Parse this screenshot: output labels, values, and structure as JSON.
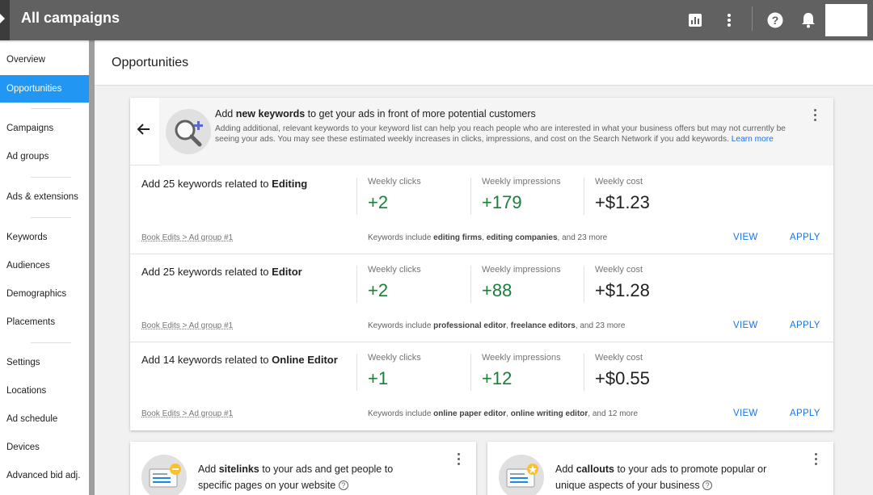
{
  "topbar": {
    "title": "All campaigns",
    "icons": [
      "reports-icon",
      "more-vert-icon",
      "help-icon",
      "notifications-icon"
    ]
  },
  "sidebar": {
    "items": [
      {
        "label": "Overview",
        "active": false
      },
      {
        "label": "Opportunities",
        "active": true
      },
      {
        "label": "Campaigns",
        "active": false
      },
      {
        "label": "Ad groups",
        "active": false
      },
      {
        "label": "Ads & extensions",
        "active": false
      },
      {
        "label": "Keywords",
        "active": false
      },
      {
        "label": "Audiences",
        "active": false
      },
      {
        "label": "Demographics",
        "active": false
      },
      {
        "label": "Placements",
        "active": false
      },
      {
        "label": "Settings",
        "active": false
      },
      {
        "label": "Locations",
        "active": false
      },
      {
        "label": "Ad schedule",
        "active": false
      },
      {
        "label": "Devices",
        "active": false
      },
      {
        "label": "Advanced bid adj.",
        "active": false
      }
    ]
  },
  "page": {
    "title": "Opportunities"
  },
  "keywords_card": {
    "title_pre": "Add ",
    "title_bold": "new keywords",
    "title_post": " to get your ads in front of more potential customers",
    "description": "Adding additional, relevant keywords to your keyword list can help you reach people who are interested in what your business offers but may not currently be seeing your ads. You may see these estimated weekly increases in clicks, impressions, and cost on the Search Network if you add keywords.",
    "learn_more": "Learn more",
    "metric_labels": {
      "clicks": "Weekly clicks",
      "impressions": "Weekly impressions",
      "cost": "Weekly cost"
    },
    "view_label": "VIEW",
    "apply_label": "APPLY",
    "rows": [
      {
        "title_pre": "Add 25 keywords related to ",
        "title_bold": "Editing",
        "clicks": "+2",
        "impressions": "+179",
        "cost": "+$1.23",
        "crumb": "Book Edits > Ad group #1",
        "kw_pre": "Keywords include ",
        "kw_a": "editing firms",
        "kw_sep": ", ",
        "kw_b": "editing companies",
        "kw_post": ", and 23 more"
      },
      {
        "title_pre": "Add 25 keywords related to ",
        "title_bold": "Editor",
        "clicks": "+2",
        "impressions": "+88",
        "cost": "+$1.28",
        "crumb": "Book Edits > Ad group #1",
        "kw_pre": "Keywords include ",
        "kw_a": "professional editor",
        "kw_sep": ", ",
        "kw_b": "freelance editors",
        "kw_post": ", and 23 more"
      },
      {
        "title_pre": "Add 14 keywords related to ",
        "title_bold": "Online Editor",
        "clicks": "+1",
        "impressions": "+12",
        "cost": "+$0.55",
        "crumb": "Book Edits > Ad group #1",
        "kw_pre": "Keywords include ",
        "kw_a": "online paper editor",
        "kw_sep": ", ",
        "kw_b": "online writing editor",
        "kw_post": ", and 12 more"
      }
    ]
  },
  "sitelinks_card": {
    "pre": "Add ",
    "bold": "sitelinks",
    "post": " to your ads and get people to",
    "line2": "specific pages on your website"
  },
  "callouts_card": {
    "pre": "Add ",
    "bold": "callouts",
    "post": " to your ads to promote popular or",
    "line2": "unique aspects of your business"
  },
  "colors": {
    "accent": "#2196f3",
    "positive": "#188038",
    "link": "#1a73e8",
    "topbar": "#616161"
  }
}
